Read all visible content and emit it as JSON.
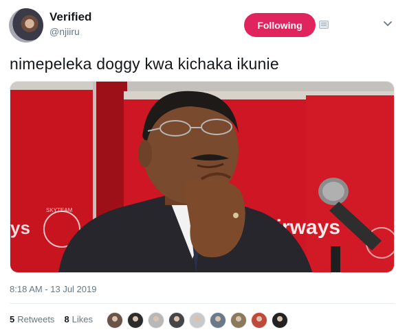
{
  "user": {
    "name": "Verified",
    "handle": "@njiiru",
    "follow_label": "Following"
  },
  "tweet": {
    "text": "nimepeleka doggy kwa kichaka ikunie",
    "timestamp": "8:18 AM - 13 Jul 2019"
  },
  "media": {
    "banner_text": "Airways",
    "skyteam_text": "SKYTEAM",
    "colors": {
      "banner": "#d51a2a",
      "background": "#bf1424",
      "suit": "#2a2a30"
    }
  },
  "stats": {
    "retweets_count": "5",
    "retweets_label": "Retweets",
    "likes_count": "8",
    "likes_label": "Likes"
  },
  "likers": [
    {
      "icon": "liker-avatar-1",
      "color": "#6b5446"
    },
    {
      "icon": "liker-avatar-2",
      "color": "#2c2c2c"
    },
    {
      "icon": "liker-avatar-3",
      "color": "#b8b8b8"
    },
    {
      "icon": "liker-avatar-4",
      "color": "#464646"
    },
    {
      "icon": "liker-avatar-5",
      "color": "#c9c9c9"
    },
    {
      "icon": "liker-avatar-6",
      "color": "#6a7a8a"
    },
    {
      "icon": "liker-avatar-7",
      "color": "#8a7a5a"
    },
    {
      "icon": "liker-avatar-8",
      "color": "#c04a3a"
    },
    {
      "icon": "liker-avatar-9",
      "color": "#222222"
    }
  ],
  "accent": "#e0245e"
}
